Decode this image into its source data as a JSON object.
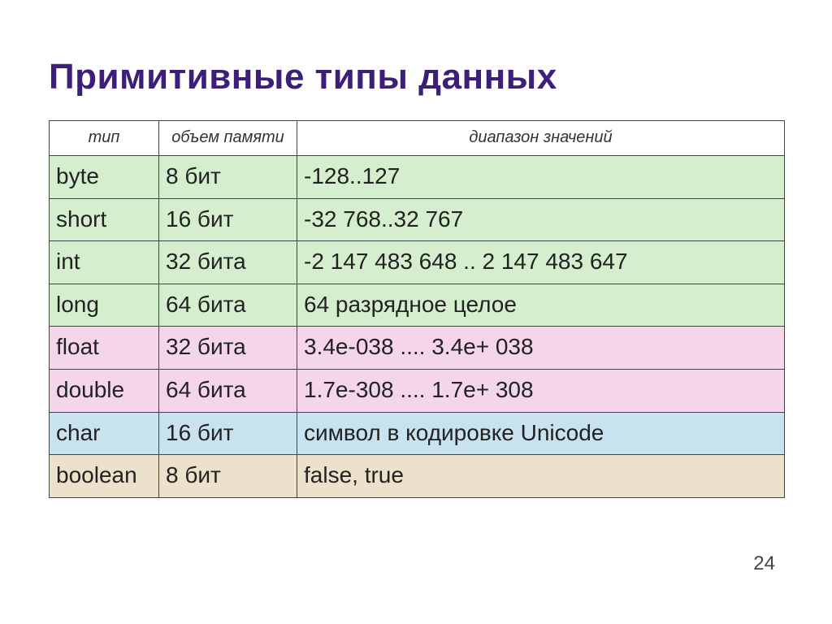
{
  "title": "Примитивные типы данных",
  "headers": {
    "type": "тип",
    "size": "объем памяти",
    "range": "диапазон значений"
  },
  "rows": [
    {
      "type": "byte",
      "size": "8 бит",
      "range": "-128..127",
      "bg": "bg-green"
    },
    {
      "type": "short",
      "size": "16 бит",
      "range": "-32 768..32 767",
      "bg": "bg-green"
    },
    {
      "type": "int",
      "size": "32 бита",
      "range": "-2 147 483 648 .. 2 147 483 647",
      "bg": "bg-green"
    },
    {
      "type": "long",
      "size": "64 бита",
      "range": "64 разрядное целое",
      "bg": "bg-green"
    },
    {
      "type": "float",
      "size": "32 бита",
      "range": "3.4e-038 .... 3.4e+ 038",
      "bg": "bg-pink"
    },
    {
      "type": "double",
      "size": "64 бита",
      "range": "1.7e-308 .... 1.7e+ 308",
      "bg": "bg-pink"
    },
    {
      "type": "char",
      "size": "16 бит",
      "range": "символ в кодировке Unicode",
      "bg": "bg-blue"
    },
    {
      "type": "boolean",
      "size": "8 бит",
      "range": "false, true",
      "bg": "bg-tan"
    }
  ],
  "page_number": "24"
}
